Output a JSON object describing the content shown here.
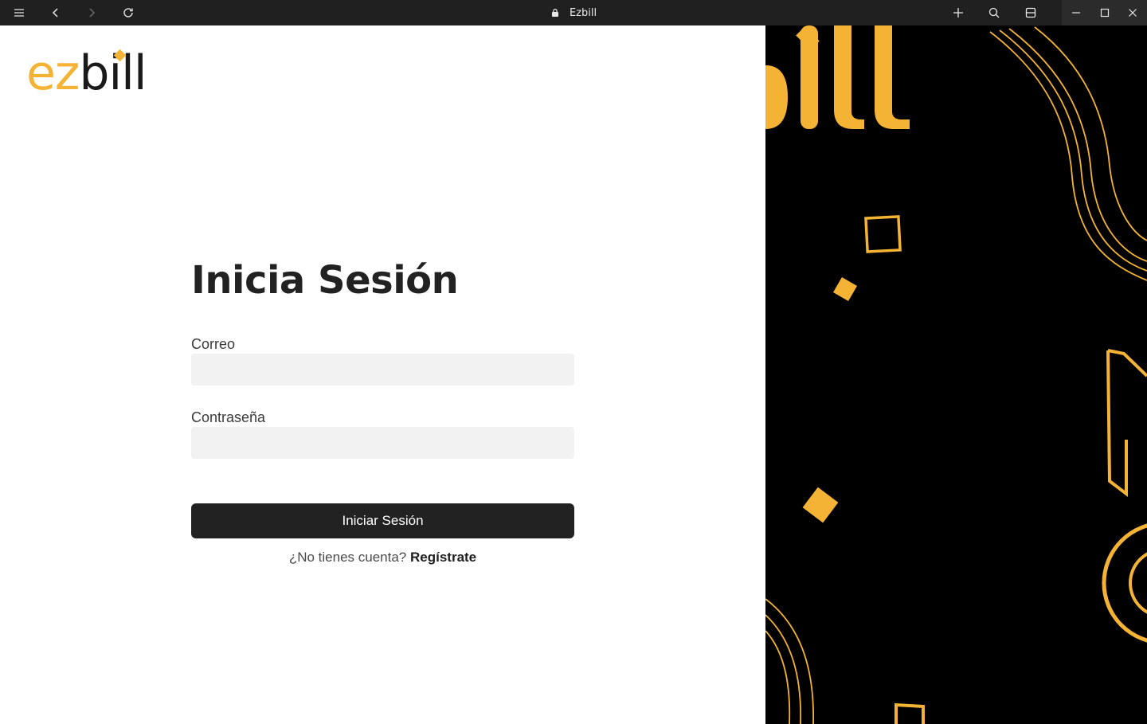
{
  "browser": {
    "title": "Ezbill",
    "icons": {
      "menu": "hamburger-icon",
      "back": "arrow-left-icon",
      "forward": "arrow-right-icon",
      "reload": "reload-icon",
      "lock": "lock-icon",
      "new_tab": "plus-icon",
      "search": "search-icon",
      "layout": "layout-icon",
      "minimize": "minimize-icon",
      "maximize": "maximize-icon",
      "close": "close-icon"
    }
  },
  "logo": {
    "part1": "ez",
    "part2": "bill",
    "colors": {
      "accent": "#F5B335",
      "dark": "#1a1a1a"
    }
  },
  "login": {
    "heading": "Inicia Sesión",
    "email_label": "Correo",
    "email_value": "",
    "password_label": "Contraseña",
    "password_value": "",
    "submit_label": "Iniciar Sesión",
    "register_prompt": "¿No tienes cuenta?",
    "register_link": "Regístrate"
  },
  "colors": {
    "accent": "#F5B335",
    "button": "#222222",
    "input_bg": "#f2f2f2",
    "right_panel_bg": "#000000"
  }
}
